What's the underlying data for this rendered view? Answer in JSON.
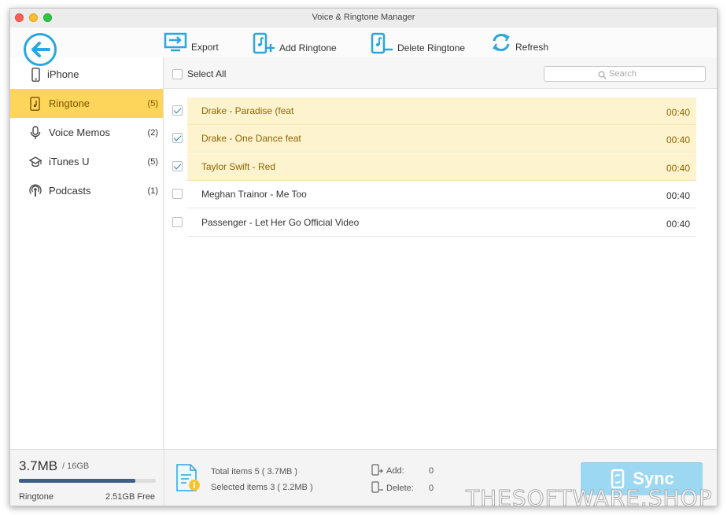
{
  "window": {
    "title": "Voice & Ringtone Manager"
  },
  "toolbar": {
    "export_label": "Export",
    "add_label": "Add Ringtone",
    "delete_label": "Delete Ringtone",
    "refresh_label": "Refresh"
  },
  "sidebar": {
    "device": {
      "label": "iPhone",
      "icon": "iphone-icon"
    },
    "items": [
      {
        "label": "Ringtone",
        "count": "(5)",
        "icon": "ringtone-icon",
        "active": true
      },
      {
        "label": "Voice Memos",
        "count": "(2)",
        "icon": "microphone-icon",
        "active": false
      },
      {
        "label": "iTunes U",
        "count": "(5)",
        "icon": "graduation-cap-icon",
        "active": false
      },
      {
        "label": "Podcasts",
        "count": "(1)",
        "icon": "podcast-icon",
        "active": false
      }
    ]
  },
  "list": {
    "select_all_label": "Select All",
    "search_placeholder": "Search",
    "rows": [
      {
        "name": "Drake - Paradise (feat",
        "duration": "00:40",
        "checked": true
      },
      {
        "name": "Drake - One Dance feat",
        "duration": "00:40",
        "checked": true
      },
      {
        "name": "Taylor Swift - Red",
        "duration": "00:40",
        "checked": true
      },
      {
        "name": "Meghan Trainor - Me Too",
        "duration": "00:40",
        "checked": false
      },
      {
        "name": "Passenger - Let Her Go Official Video",
        "duration": "00:40",
        "checked": false
      }
    ]
  },
  "footer": {
    "storage_used": "3.7MB",
    "storage_total": "/ 16GB",
    "storage_fraction": 0.85,
    "storage_category": "Ringtone",
    "storage_free": "2.51GB Free",
    "total_text": "Total items 5 ( 3.7MB )",
    "selected_text": "Selected items 3 ( 2.2MB )",
    "add_label": "Add:",
    "add_value": "0",
    "delete_label": "Delete:",
    "delete_value": "0",
    "sync_label": "Sync"
  },
  "watermark": "THESOFTWARE.SHOP",
  "colors": {
    "accent": "#2ba6df",
    "selected_sidebar": "#fdd55b",
    "selected_row": "#fdf4cf",
    "sync_button": "#9dd8f3"
  }
}
